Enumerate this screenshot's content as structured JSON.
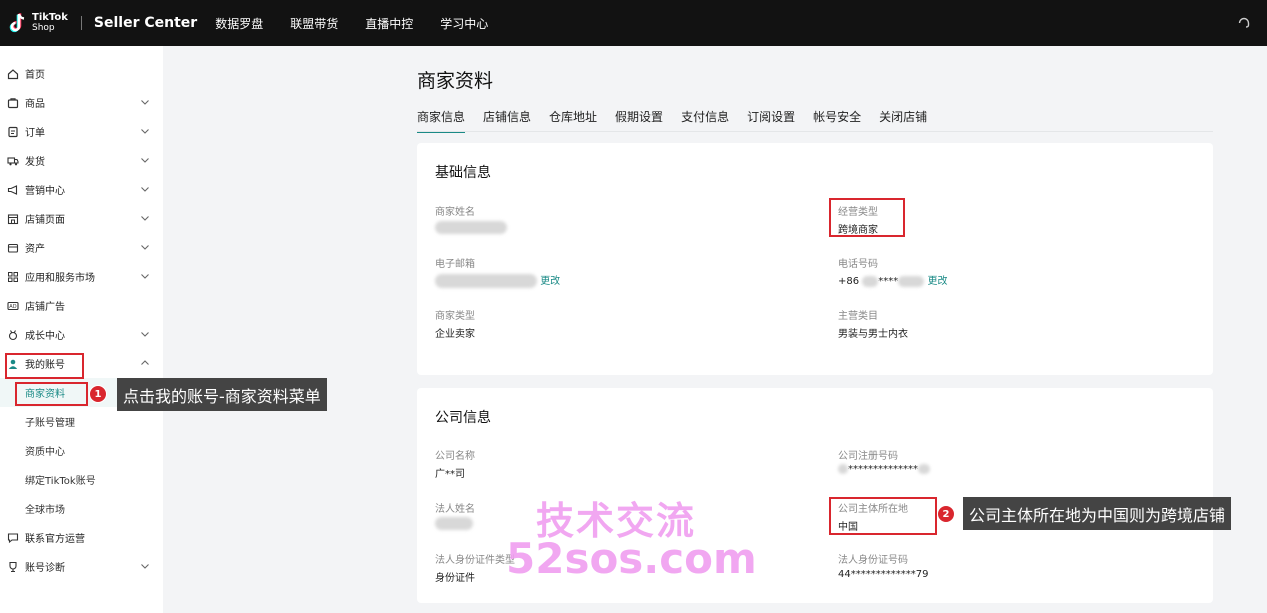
{
  "topbar": {
    "logo_top": "TikTok",
    "logo_bottom": "Shop",
    "brand": "Seller Center",
    "nav": [
      "数据罗盘",
      "联盟带货",
      "直播中控",
      "学习中心"
    ]
  },
  "sidebar": {
    "items": [
      {
        "label": "首页",
        "icon": "home-icon"
      },
      {
        "label": "商品",
        "icon": "product-icon"
      },
      {
        "label": "订单",
        "icon": "order-icon"
      },
      {
        "label": "发货",
        "icon": "truck-icon"
      },
      {
        "label": "营销中心",
        "icon": "megaphone-icon"
      },
      {
        "label": "店铺页面",
        "icon": "store-icon"
      },
      {
        "label": "资产",
        "icon": "wallet-icon"
      },
      {
        "label": "应用和服务市场",
        "icon": "apps-icon"
      },
      {
        "label": "店铺广告",
        "icon": "ad-icon"
      },
      {
        "label": "成长中心",
        "icon": "medal-icon"
      },
      {
        "label": "我的账号",
        "icon": "user-icon"
      },
      {
        "label": "联系官方运营",
        "icon": "chat-icon"
      },
      {
        "label": "账号诊断",
        "icon": "trophy-icon"
      }
    ],
    "sub_items": [
      "商家资料",
      "子账号管理",
      "资质中心",
      "绑定TikTok账号",
      "全球市场"
    ]
  },
  "page": {
    "title": "商家资料",
    "tabs": [
      "商家信息",
      "店铺信息",
      "仓库地址",
      "假期设置",
      "支付信息",
      "订阅设置",
      "帐号安全",
      "关闭店铺"
    ]
  },
  "basic": {
    "title": "基础信息",
    "merchant_name_label": "商家姓名",
    "biz_type_label": "经营类型",
    "biz_type_value": "跨境商家",
    "email_label": "电子邮箱",
    "email_edit": "更改",
    "phone_label": "电话号码",
    "phone_value_a": "+86",
    "phone_value_b": "****",
    "phone_edit": "更改",
    "merchant_type_label": "商家类型",
    "merchant_type_value": "企业卖家",
    "category_label": "主营类目",
    "category_value": "男装与男士内衣"
  },
  "company": {
    "title": "公司信息",
    "name_label": "公司名称",
    "name_value": "广**司",
    "reg_label": "公司注册号码",
    "reg_value": "**************",
    "legal_name_label": "法人姓名",
    "location_label": "公司主体所在地",
    "location_value": "中国",
    "id_type_label": "法人身份证件类型",
    "id_type_value": "身份证件",
    "id_no_label": "法人身份证号码",
    "id_no_value": "44*************79"
  },
  "annotations": {
    "callout1": "点击我的账号-商家资料菜单",
    "callout2": "公司主体所在地为中国则为跨境店铺",
    "badge1": "1",
    "badge2": "2"
  },
  "watermark": {
    "line1": "技术交流",
    "line2": "52sos.com"
  },
  "colors": {
    "accent": "#1a8a86",
    "highlight": "#d9262e",
    "watermark": "#f09ef0"
  }
}
